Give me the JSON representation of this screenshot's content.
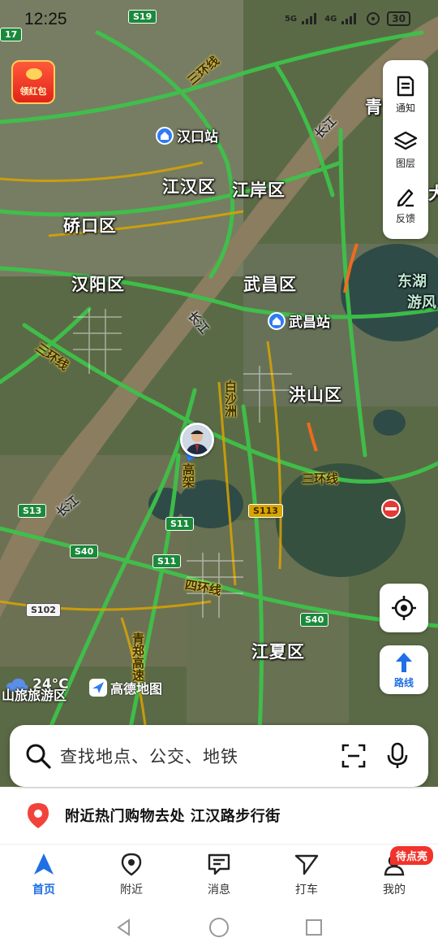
{
  "status_bar": {
    "time": "12:25",
    "signal_left": "5G",
    "signal_right": "4G",
    "battery": "30"
  },
  "map": {
    "districts": [
      "江汉区",
      "江岸区",
      "硚口区",
      "汉阳区",
      "武昌区",
      "洪山区",
      "江夏区"
    ],
    "stations": [
      "汉口站",
      "武昌站"
    ],
    "road_labels": [
      "三环线",
      "三环线",
      "三环线",
      "四环线",
      "长江",
      "长江",
      "长江",
      "白沙洲",
      "高架",
      "青郑高速"
    ],
    "shields": [
      "S19",
      "S13",
      "S11",
      "S11",
      "S40",
      "S40",
      "S113",
      "S102",
      "17"
    ],
    "partial_labels": [
      "青",
      "东湖",
      "游风",
      "大"
    ],
    "region_label": "山旅旅游区",
    "temperature": "24°C",
    "logo_text": "高德地图"
  },
  "red_packet": {
    "label": "领红包"
  },
  "right_tools": [
    {
      "label": "通知",
      "icon": "notice-icon"
    },
    {
      "label": "图层",
      "icon": "layers-icon"
    },
    {
      "label": "反馈",
      "icon": "feedback-icon"
    }
  ],
  "route_button": {
    "label": "路线"
  },
  "search": {
    "placeholder": "查找地点、公交、地铁"
  },
  "suggestion": {
    "text": "附近热门购物去处 江汉路步行街"
  },
  "tabs": [
    {
      "label": "首页",
      "icon": "home-icon"
    },
    {
      "label": "附近",
      "icon": "nearby-icon"
    },
    {
      "label": "消息",
      "icon": "message-icon"
    },
    {
      "label": "打车",
      "icon": "taxi-icon"
    },
    {
      "label": "我的",
      "icon": "profile-icon"
    }
  ],
  "mine_badge": "待点亮",
  "colors": {
    "accent": "#1f6fe5",
    "road_green": "#3ec24a",
    "road_yellow": "#d9a400",
    "river": "#8a7d60",
    "badge_red": "#f2332b"
  }
}
